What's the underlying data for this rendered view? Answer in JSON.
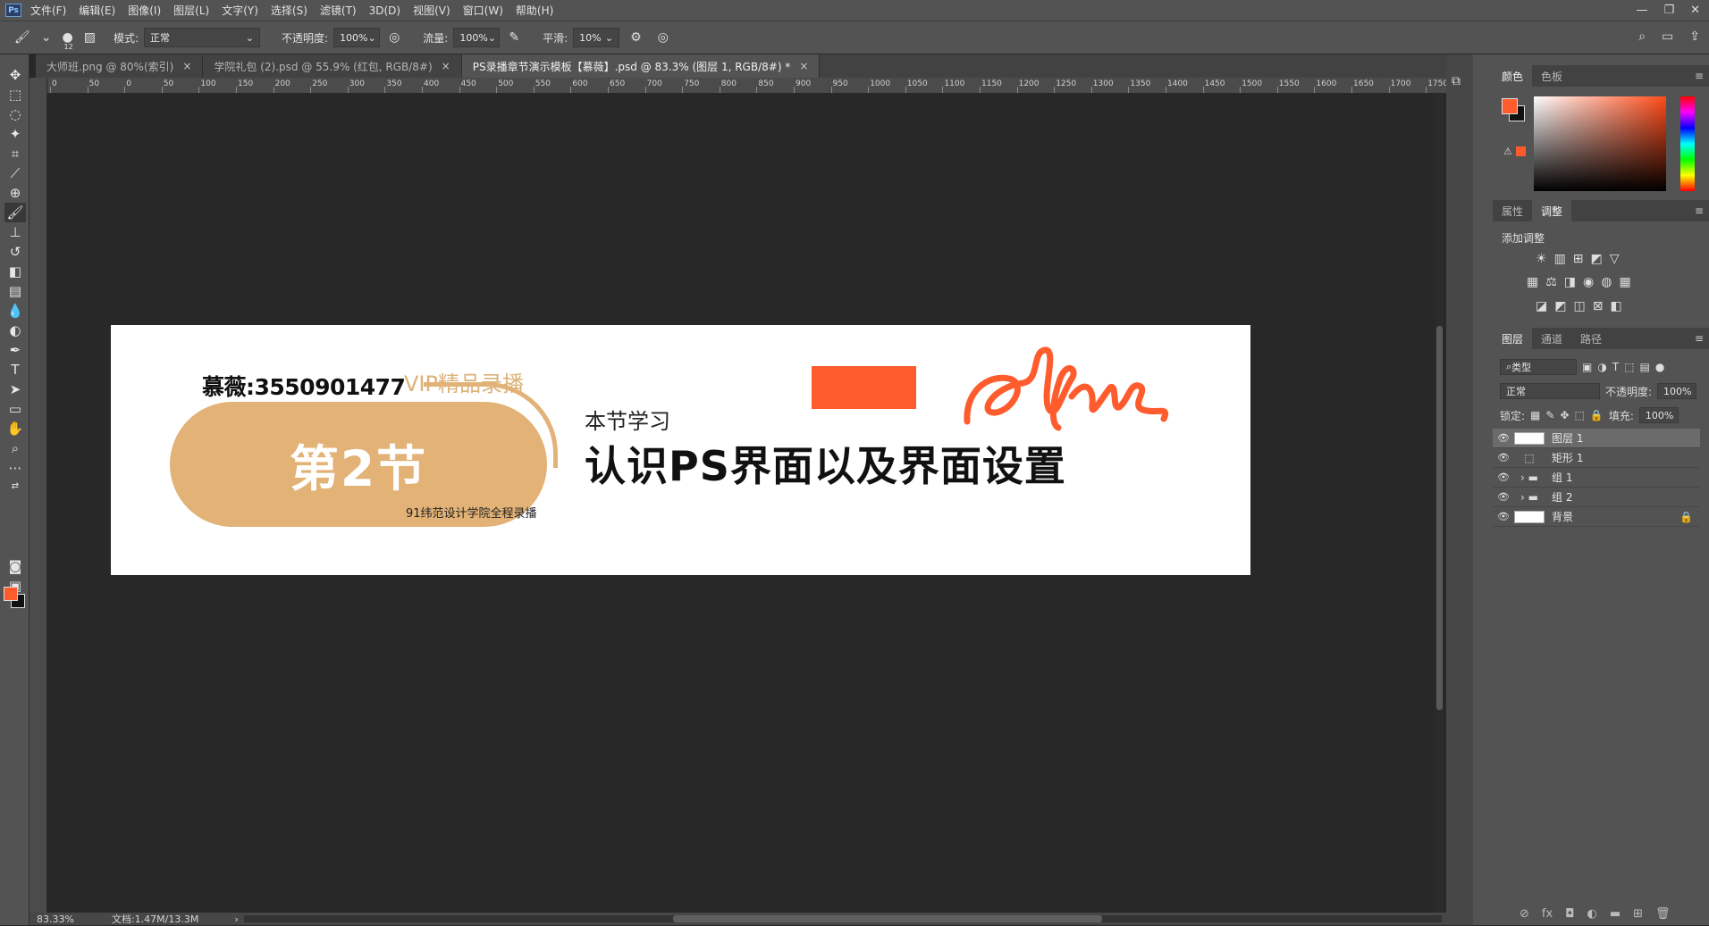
{
  "menubar": {
    "logo": "Ps",
    "items": [
      "文件(F)",
      "编辑(E)",
      "图像(I)",
      "图层(L)",
      "文字(Y)",
      "选择(S)",
      "滤镜(T)",
      "3D(D)",
      "视图(V)",
      "窗口(W)",
      "帮助(H)"
    ],
    "window_controls": [
      "—",
      "❐",
      "✕"
    ]
  },
  "options": {
    "brush_size": "12",
    "mode_label": "模式:",
    "mode_value": "正常",
    "opacity_label": "不透明度:",
    "opacity_value": "100%",
    "flow_label": "流量:",
    "flow_value": "100%",
    "smooth_label": "平滑:",
    "smooth_value": "10%"
  },
  "tabs": [
    {
      "label": "大师班.png @ 80%(索引)",
      "close": "×"
    },
    {
      "label": "学院礼包 (2).psd @ 55.9% (红包, RGB/8#)",
      "close": "×"
    },
    {
      "label": "PS录播章节演示模板【慕薇】.psd @ 83.3% (图层 1, RGB/8#) *",
      "close": "×"
    }
  ],
  "ruler": {
    "top_labels": [
      "0",
      "50",
      "0",
      "50",
      "100",
      "150",
      "200",
      "250",
      "300",
      "350",
      "400",
      "450",
      "500",
      "550",
      "600",
      "650",
      "700",
      "750",
      "800",
      "850",
      "900",
      "950",
      "1000",
      "1050",
      "1100",
      "1150",
      "1200",
      "1250",
      "1300",
      "1350",
      "1400",
      "1450",
      "1500",
      "1550",
      "1600",
      "1650",
      "1700",
      "1750"
    ]
  },
  "canvas": {
    "phone": "慕薇:3550901477",
    "vip": "VIP精品录播",
    "pill_text": "第2节",
    "tiny_text": "91纬范设计学院全程录播",
    "subtitle": "本节学习",
    "title": "认识PS界面以及界面设置",
    "orange_color": "#ff5c2e",
    "pill_color": "#e2b276"
  },
  "status": {
    "zoom": "83.33%",
    "doc": "文档:1.47M/13.3M",
    "arrow": "›"
  },
  "panels": {
    "color_tabs": [
      "颜色",
      "色板"
    ],
    "prop_tabs": [
      "属性",
      "调整"
    ],
    "adj_label": "添加调整",
    "layers_tabs": [
      "图层",
      "通道",
      "路径"
    ],
    "kind": "类型",
    "blend": "正常",
    "opacity_label": "不透明度:",
    "opacity": "100%",
    "lock_label": "锁定:",
    "fill_label": "填充:",
    "fill": "100%",
    "layers": [
      {
        "name": "图层 1",
        "selected": true
      },
      {
        "name": "矩形 1",
        "selected": false
      },
      {
        "name": "组 1",
        "selected": false
      },
      {
        "name": "组 2",
        "selected": false
      },
      {
        "name": "背景",
        "selected": false
      }
    ],
    "menu": "≡"
  }
}
